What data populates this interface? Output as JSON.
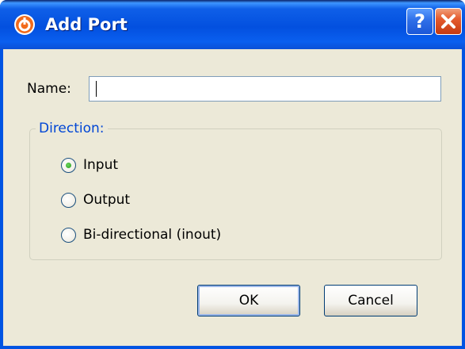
{
  "dialog": {
    "title": "Add Port",
    "help_glyph": "?",
    "close_glyph": "✕"
  },
  "form": {
    "name_label": "Name:",
    "name_value": "",
    "direction_legend": "Direction:",
    "options": [
      {
        "label": "Input",
        "checked": true
      },
      {
        "label": "Output",
        "checked": false
      },
      {
        "label": "Bi-directional (inout)",
        "checked": false
      }
    ]
  },
  "buttons": {
    "ok_label": "OK",
    "cancel_label": "Cancel"
  },
  "icons": {
    "app": "power-icon",
    "help": "help-icon",
    "close": "close-icon"
  },
  "colors": {
    "titlebar": "#0054e3",
    "client_bg": "#ece9d8",
    "legend_text": "#0046d5",
    "close_button": "#e55b2e",
    "radio_dot": "#2a9b1f"
  }
}
